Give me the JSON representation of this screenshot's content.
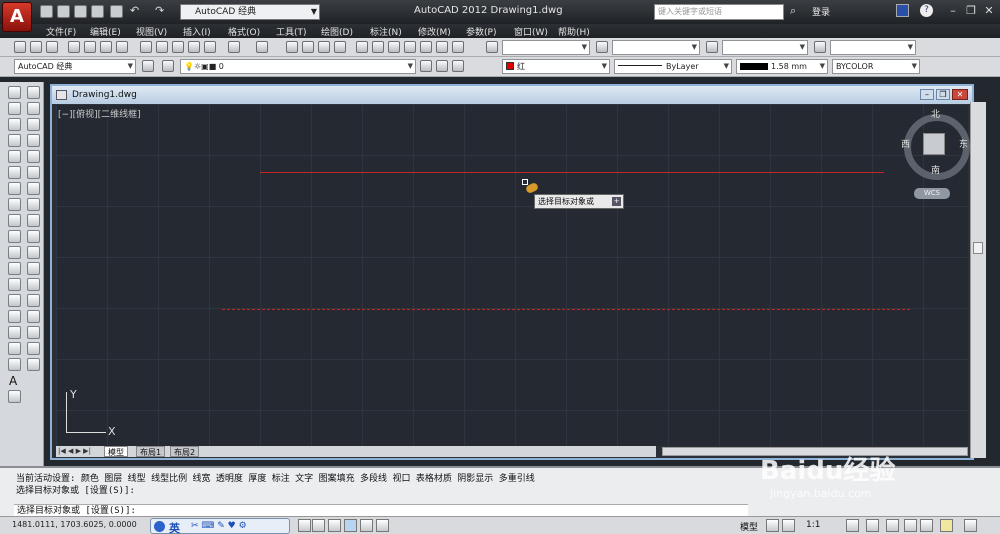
{
  "app_title": "AutoCAD 2012    Drawing1.dwg",
  "app_button_letter": "A",
  "workspace": "AutoCAD 经典",
  "search_placeholder": "键入关键字或短语",
  "login": "登录",
  "menu": [
    "文件(F)",
    "编辑(E)",
    "视图(V)",
    "插入(I)",
    "格式(O)",
    "工具(T)",
    "绘图(D)",
    "标注(N)",
    "修改(M)",
    "参数(P)",
    "窗口(W)",
    "帮助(H)"
  ],
  "toolbar2": {
    "workspace": "AutoCAD 经典",
    "layer": "0",
    "color": "红",
    "linetype": "ByLayer",
    "lineweight": "1.58 mm",
    "plotstyle": "BYCOLOR"
  },
  "drawing": {
    "title": "Drawing1.dwg",
    "viewport_label": "[−][俯视][二维线框]",
    "tooltip": "选择目标对象或",
    "viewcube": {
      "north": "北",
      "south": "南",
      "east": "东",
      "west": "西",
      "wcs": "WCS"
    },
    "ucs": {
      "x": "X",
      "y": "Y"
    },
    "tabs": [
      "模型",
      "布局1",
      "布局2"
    ]
  },
  "command": {
    "line1": "当前活动设置:  颜色 图层 线型 线型比例 线宽 透明度 厚度 标注 文字 图案填充 多段线 视口 表格材质 阴影显示 多重引线",
    "line2": "选择目标对象或 [设置(S)]:",
    "input": "选择目标对象或 [设置(S)]:"
  },
  "status": {
    "coords": "1481.0111, 1703.6025, 0.0000",
    "ime": "英",
    "model": "模型",
    "scale": "1:1"
  },
  "watermark": {
    "brand": "Baidu经验",
    "url": "jingyan.baidu.com"
  },
  "colors": {
    "accent_red": "#c22525",
    "canvas_bg": "#252a32",
    "titlebar": "#1f2226"
  }
}
